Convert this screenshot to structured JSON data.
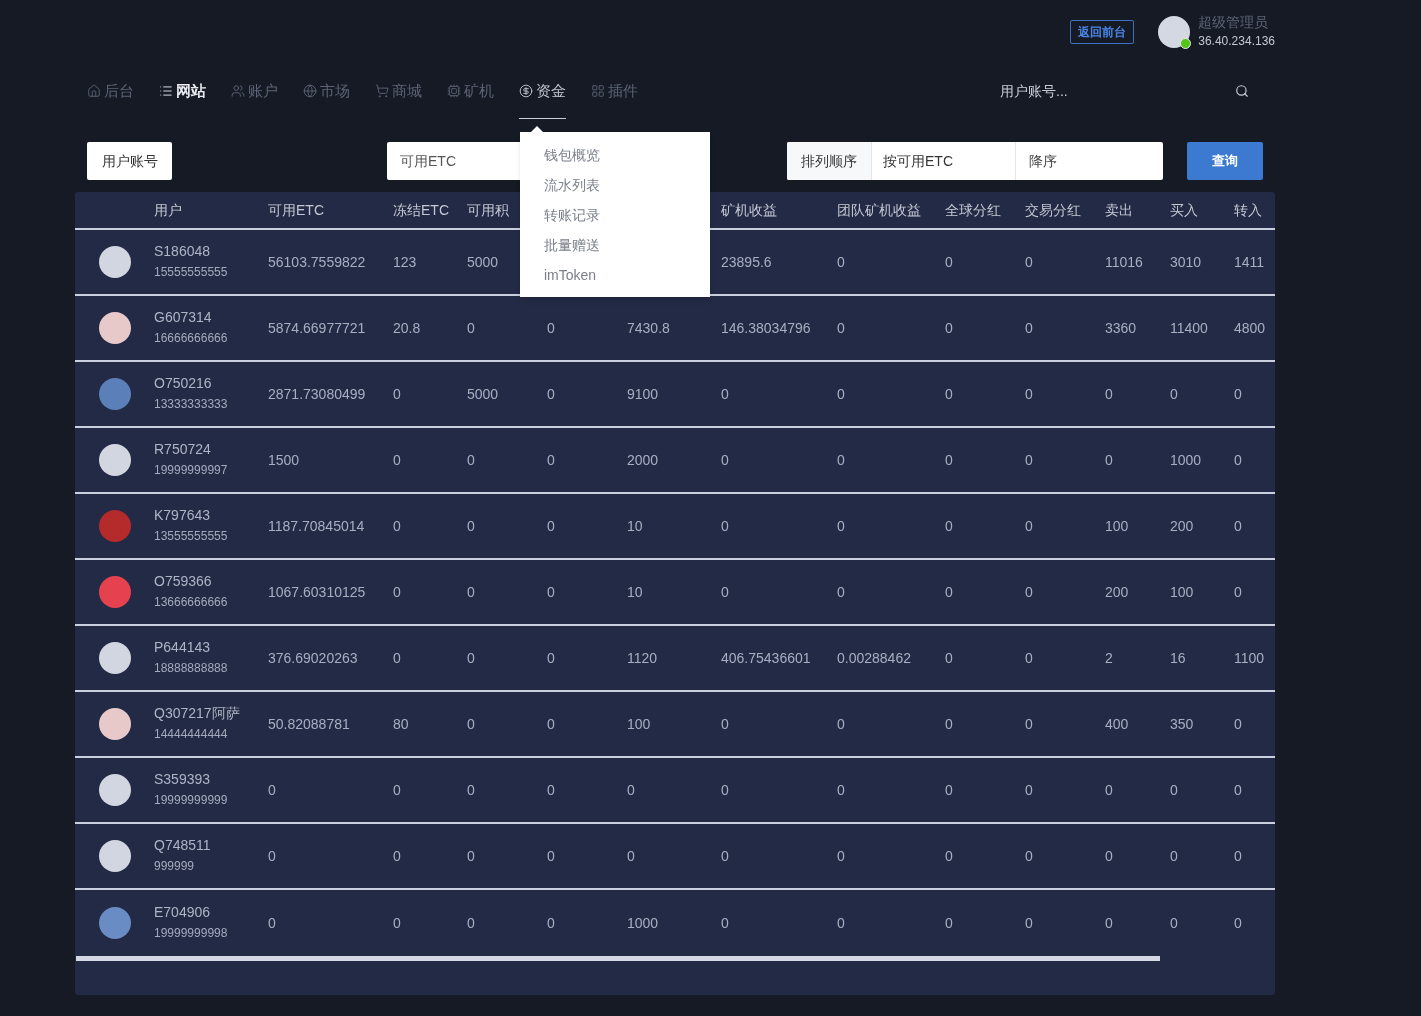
{
  "header": {
    "back_button": "返回前台",
    "admin": {
      "name": "超级管理员",
      "ip": "36.40.234.136",
      "online": true
    }
  },
  "nav": {
    "items": [
      {
        "label": "后台",
        "selected": false,
        "expanded": false
      },
      {
        "label": "网站",
        "selected": true,
        "expanded": false
      },
      {
        "label": "账户",
        "selected": false,
        "expanded": false
      },
      {
        "label": "市场",
        "selected": false,
        "expanded": false
      },
      {
        "label": "商城",
        "selected": false,
        "expanded": false
      },
      {
        "label": "矿机",
        "selected": false,
        "expanded": false
      },
      {
        "label": "资金",
        "selected": false,
        "expanded": true,
        "menu": [
          "钱包概览",
          "流水列表",
          "转账记录",
          "批量赠送",
          "imToken"
        ]
      },
      {
        "label": "插件",
        "selected": false,
        "expanded": false
      }
    ],
    "search": {
      "placeholder": "用户账号..."
    }
  },
  "filters": {
    "field_select": "用户账号",
    "amount_select": "可用ETC",
    "sort": {
      "label": "排列顺序",
      "by": "按可用ETC",
      "order": "降序"
    },
    "query_button": "查询"
  },
  "table": {
    "columns": [
      null,
      "用户",
      "可用ETC",
      "冻结ETC",
      "可用积",
      null,
      null,
      "矿机收益",
      "团队矿机收益",
      "全球分红",
      "交易分红",
      "卖出",
      "买入",
      "转入"
    ],
    "rows": [
      {
        "cells": [
          {
            "kind": "default"
          },
          {
            "user": "S186048",
            "phone": "15555555555"
          },
          "56103.7559822",
          "123",
          "5000",
          null,
          null,
          "23895.6",
          "0",
          "0",
          "0",
          "11016",
          "3010",
          "1411"
        ]
      },
      {
        "cells": [
          {
            "kind": "photo",
            "color": "#e7c9c9"
          },
          {
            "user": "G607314",
            "phone": "16666666666"
          },
          "5874.66977721",
          "20.8",
          "0",
          "0",
          "7430.8",
          "146.38034796",
          "0",
          "0",
          "0",
          "3360",
          "11400",
          "4800"
        ]
      },
      {
        "cells": [
          {
            "kind": "photo",
            "color": "#5b7fb8"
          },
          {
            "user": "O750216",
            "phone": "13333333333"
          },
          "2871.73080499",
          "0",
          "5000",
          "0",
          "9100",
          "0",
          "0",
          "0",
          "0",
          "0",
          "0",
          "0"
        ]
      },
      {
        "cells": [
          {
            "kind": "default"
          },
          {
            "user": "R750724",
            "phone": "19999999997"
          },
          "1500",
          "0",
          "0",
          "0",
          "2000",
          "0",
          "0",
          "0",
          "0",
          "0",
          "1000",
          "0"
        ]
      },
      {
        "cells": [
          {
            "kind": "photo",
            "color": "#b52a2a"
          },
          {
            "user": "K797643",
            "phone": "13555555555"
          },
          "1187.70845014",
          "0",
          "0",
          "0",
          "10",
          "0",
          "0",
          "0",
          "0",
          "100",
          "200",
          "0"
        ]
      },
      {
        "cells": [
          {
            "kind": "photo",
            "color": "#e6414f"
          },
          {
            "user": "O759366",
            "phone": "13666666666"
          },
          "1067.60310125",
          "0",
          "0",
          "0",
          "10",
          "0",
          "0",
          "0",
          "0",
          "200",
          "100",
          "0"
        ]
      },
      {
        "cells": [
          {
            "kind": "default"
          },
          {
            "user": "P644143",
            "phone": "18888888888"
          },
          "376.69020263",
          "0",
          "0",
          "0",
          "1120",
          "406.75436601",
          "0.00288462",
          "0",
          "0",
          "2",
          "16",
          "1100"
        ]
      },
      {
        "cells": [
          {
            "kind": "photo",
            "color": "#e7c9c9"
          },
          {
            "user": "Q307217阿萨",
            "phone": "14444444444"
          },
          "50.82088781",
          "80",
          "0",
          "0",
          "100",
          "0",
          "0",
          "0",
          "0",
          "400",
          "350",
          "0"
        ]
      },
      {
        "cells": [
          {
            "kind": "default"
          },
          {
            "user": "S359393",
            "phone": "19999999999"
          },
          "0",
          "0",
          "0",
          "0",
          "0",
          "0",
          "0",
          "0",
          "0",
          "0",
          "0",
          "0"
        ]
      },
      {
        "cells": [
          {
            "kind": "default"
          },
          {
            "user": "Q748511",
            "phone": "999999"
          },
          "0",
          "0",
          "0",
          "0",
          "0",
          "0",
          "0",
          "0",
          "0",
          "0",
          "0",
          "0"
        ]
      },
      {
        "cells": [
          {
            "kind": "photo",
            "color": "#6a8cc4"
          },
          {
            "user": "E704906",
            "phone": "19999999998"
          },
          "0",
          "0",
          "0",
          "0",
          "1000",
          "0",
          "0",
          "0",
          "0",
          "0",
          "0",
          "0"
        ]
      }
    ]
  }
}
